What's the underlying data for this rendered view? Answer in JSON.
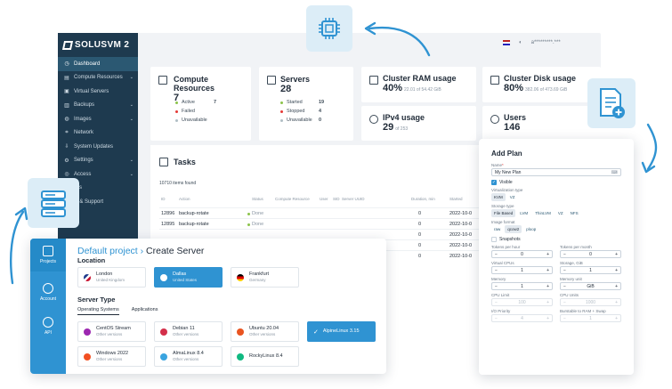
{
  "app": {
    "logo": "SOLUSVM 2",
    "user_email": "a*********.***",
    "colors": {
      "sidebar": "#1e3a4f",
      "accent": "#2f93d2",
      "active_dot": "#8bc34a",
      "failed_dot": "#e53935",
      "stopped_dot": "#e53935",
      "unavail_dot": "#b0bec5"
    }
  },
  "sidebar": {
    "items": [
      {
        "label": "Dashboard",
        "icon": "dashboard-icon",
        "glyph": "◷",
        "active": true,
        "chevron": ""
      },
      {
        "label": "Compute Resources",
        "icon": "compute-icon",
        "glyph": "▤",
        "active": false,
        "chevron": "⌄"
      },
      {
        "label": "Virtual Servers",
        "icon": "server-icon",
        "glyph": "▣",
        "active": false,
        "chevron": ""
      },
      {
        "label": "Backups",
        "icon": "backup-icon",
        "glyph": "▥",
        "active": false,
        "chevron": "⌄"
      },
      {
        "label": "Images",
        "icon": "image-icon",
        "glyph": "◍",
        "active": false,
        "chevron": "⌄"
      },
      {
        "label": "Network",
        "icon": "network-icon",
        "glyph": "⌗",
        "active": false,
        "chevron": ""
      },
      {
        "label": "System Updates",
        "icon": "updates-icon",
        "glyph": "⇩",
        "active": false,
        "chevron": ""
      },
      {
        "label": "Settings",
        "icon": "gear-icon",
        "glyph": "⚙",
        "active": false,
        "chevron": "⌄"
      },
      {
        "label": "Access",
        "icon": "access-icon",
        "glyph": "◎",
        "active": false,
        "chevron": "⌄"
      },
      {
        "label": "sks",
        "icon": "tasks-icon",
        "glyph": "",
        "active": false,
        "chevron": ""
      },
      {
        "label": "lp & Support",
        "icon": "help-icon",
        "glyph": "",
        "active": false,
        "chevron": ""
      }
    ]
  },
  "stats": {
    "compute": {
      "title": "Compute Resources",
      "value": "7",
      "rows": [
        {
          "label": "Active",
          "num": "7",
          "dot": "#8bc34a"
        },
        {
          "label": "Failed",
          "num": "",
          "dot": "#e53935"
        },
        {
          "label": "Unavailable",
          "num": "",
          "dot": "#b0bec5"
        }
      ]
    },
    "servers": {
      "title": "Servers",
      "value": "28",
      "rows": [
        {
          "label": "Started",
          "num": "19",
          "dot": "#8bc34a"
        },
        {
          "label": "Stopped",
          "num": "4",
          "dot": "#e53935"
        },
        {
          "label": "Unavailable",
          "num": "0",
          "dot": "#b0bec5"
        }
      ]
    },
    "ram": {
      "title": "Cluster RAM usage",
      "value": "40%",
      "sub": "22.01 of 54.42 GiB"
    },
    "disk": {
      "title": "Cluster Disk usage",
      "value": "80%",
      "sub": "382.06 of 473.69 GiB"
    },
    "ipv4": {
      "title": "IPv4 usage",
      "value": "29",
      "sub": "of 253"
    },
    "users": {
      "title": "Users",
      "value": "146"
    }
  },
  "tasks": {
    "title": "Tasks",
    "count": "10710 items found",
    "columns": [
      "ID",
      "Action",
      "Status",
      "Compute Resource",
      "User",
      "SID",
      "Server UUID",
      "Duration, min",
      "Started"
    ],
    "rows": [
      {
        "id": "12896",
        "action": "backup-rotate",
        "status": "Done",
        "duration": "0",
        "started": "2022-10-0"
      },
      {
        "id": "12895",
        "action": "backup-rotate",
        "status": "Done",
        "duration": "0",
        "started": "2022-10-0"
      },
      {
        "id": "",
        "action": "",
        "status": "",
        "duration": "0",
        "started": "2022-10-0"
      },
      {
        "id": "",
        "action": "",
        "status": "",
        "duration": "0",
        "started": "2022-10-0"
      },
      {
        "id": "",
        "action": "",
        "status": "",
        "duration": "0",
        "started": "2022-10-0"
      }
    ]
  },
  "plan": {
    "title": "Add Plan",
    "name_label": "Name",
    "name_value": "My New Plan",
    "visible_label": "Visible",
    "virt_label": "Virtualization type",
    "virt_options": [
      "KVM",
      "VZ"
    ],
    "storage_label": "Storage type",
    "storage_options": [
      "File Based",
      "LVM",
      "ThinLVM",
      "VZ",
      "NFS"
    ],
    "image_label": "Image format",
    "image_options": [
      "raw",
      "qcow2",
      "ploop"
    ],
    "snapshots_label": "Snapshots",
    "fields": [
      {
        "left_label": "Tokens per hour",
        "left_value": "0",
        "right_label": "Tokens per month",
        "right_value": "0",
        "disabled": false
      },
      {
        "left_label": "Virtual CPUs",
        "left_value": "1",
        "right_label": "Storage, GiB",
        "right_value": "1",
        "disabled": false
      },
      {
        "left_label": "Memory",
        "left_value": "1",
        "right_label": "Memory unit",
        "right_value": "GiB",
        "disabled": false
      },
      {
        "left_label": "CPU Limit",
        "left_value": "100",
        "right_label": "CPU Units",
        "right_value": "1000",
        "disabled": true
      },
      {
        "left_label": "I/O Priority",
        "left_value": "4",
        "right_label": "Burstable to RAM + Swap",
        "right_value": "1",
        "disabled": true
      }
    ]
  },
  "server": {
    "project": "Default project",
    "title": "Create Server",
    "nav": [
      {
        "label": "Projects",
        "icon": "projects-icon"
      },
      {
        "label": "Account",
        "icon": "account-icon"
      },
      {
        "label": "API",
        "icon": "api-icon"
      }
    ],
    "location_title": "Location",
    "locations": [
      {
        "name": "London",
        "sub": "United Kingdom",
        "selected": false,
        "flag": "uk-flag-icon"
      },
      {
        "name": "Dallas",
        "sub": "United States",
        "selected": true,
        "flag": "pin-icon"
      },
      {
        "name": "Frankfurt",
        "sub": "Germany",
        "selected": false,
        "flag": "de-flag-icon"
      }
    ],
    "type_title": "Server Type",
    "tabs": [
      "Operating Systems",
      "Applications"
    ],
    "os": [
      {
        "name": "CentOS Stream",
        "sub": "Other versions",
        "selected": false,
        "color": "#9c27b0"
      },
      {
        "name": "Debian 11",
        "sub": "Other versions",
        "selected": false,
        "color": "#d32f4a"
      },
      {
        "name": "Ubuntu 20.04",
        "sub": "Other versions",
        "selected": false,
        "color": "#e95420"
      },
      {
        "name": "AlpineLinux 3.15",
        "sub": "",
        "selected": true,
        "color": "#ffffff"
      },
      {
        "name": "Windows 2022",
        "sub": "Other versions",
        "selected": false,
        "color": "#f25022"
      },
      {
        "name": "AlmaLinux 8.4",
        "sub": "Other versions",
        "selected": false,
        "color": "#3aa4e0"
      },
      {
        "name": "RockyLinux 8.4",
        "sub": "",
        "selected": false,
        "color": "#10b981"
      }
    ]
  }
}
